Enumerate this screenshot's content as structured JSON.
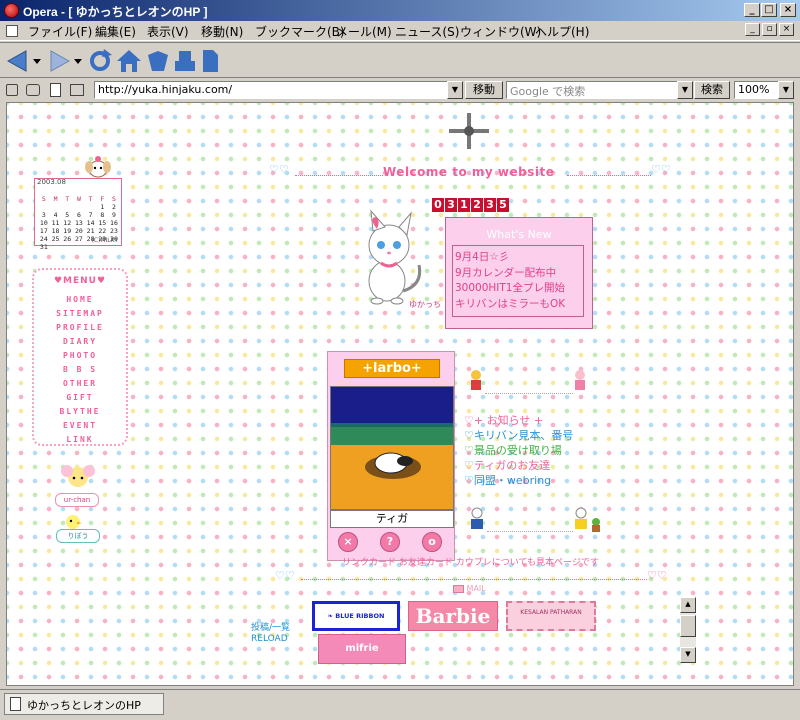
{
  "window": {
    "title": "Opera - [ ゆかっちとレオンのHP ]",
    "minimize": "_",
    "maximize": "□",
    "close": "×",
    "restore": "▫"
  },
  "menu": [
    "ファイル(F)",
    "編集(E)",
    "表示(V)",
    "移動(N)",
    "ブックマーク(B)",
    "メール(M)",
    "ニュース(S)",
    "ウィンドウ(W)",
    "ヘルプ(H)"
  ],
  "address": {
    "url": "http://yuka.hinjaku.com/",
    "go_label": "移動",
    "search_placeholder": "Google で検索",
    "search_label": "検索",
    "zoom": "100%"
  },
  "page": {
    "welcome": "Welcome to my website",
    "counter": [
      "0",
      "3",
      "1",
      "2",
      "3",
      "5"
    ],
    "calendar": {
      "header": "2003.08",
      "weekdays": [
        "S",
        "M",
        "T",
        "W",
        "T",
        "F",
        "S"
      ],
      "weeks": [
        [
          "",
          "",
          "",
          "",
          "",
          "1",
          "2"
        ],
        [
          "3",
          "4",
          "5",
          "6",
          "7",
          "8",
          "9"
        ],
        [
          "10",
          "11",
          "12",
          "13",
          "14",
          "15",
          "16"
        ],
        [
          "17",
          "18",
          "19",
          "20",
          "21",
          "22",
          "23"
        ],
        [
          "24",
          "25",
          "26",
          "27",
          "28",
          "29",
          "30"
        ],
        [
          "31",
          "",
          "",
          "",
          "",
          "",
          ""
        ]
      ],
      "copyright": "(C)MILKY"
    },
    "menu_title": "♥MENU♥",
    "menu_items": [
      "HOME",
      "SITEMAP",
      "PROFILE",
      "DIARY",
      "PHOTO",
      "B B S",
      "OTHER",
      "GIFT",
      "BLYTHE",
      "EVENT",
      "LINK"
    ],
    "side_chars": [
      "ur-chan",
      "りぼう"
    ],
    "cat_caption": "ゆかっち",
    "whats_new": {
      "title": "What's New",
      "items": [
        "9月4日☆彡",
        "9月カレンダー配布中",
        "30000HIT1全プレ開始",
        "キリバンはミラーもOK"
      ]
    },
    "harbot": {
      "logo": "+larbo+",
      "name": "ティガ",
      "buttons": [
        "×",
        "?",
        "o"
      ]
    },
    "info_items": [
      {
        "text": "+ お知らせ +",
        "color": "#f0609a"
      },
      {
        "text": "キリバン見本、番号",
        "color": "#2a8fd0"
      },
      {
        "text": "景品の受け取り場",
        "color": "#40b040"
      },
      {
        "text": "ティガのお友達",
        "color": "#f0609a"
      },
      {
        "text": "同盟・webring",
        "color": "#2a8fd0"
      }
    ],
    "caption": "リンクカード お友達カード カウプレについても見本ページです",
    "mail_label": "MAIL",
    "posts": [
      "投稿/一覧",
      "RELOAD"
    ],
    "banners": {
      "blue_ribbon": "BLUE RIBBON",
      "barbie": "Barbie",
      "kesalan": "KESALAN PATHARAN",
      "mifrie": "mifrie"
    }
  },
  "status": {
    "tab_title": "ゆかっちとレオンのHP"
  },
  "colors": {
    "accent_pink": "#f0609a",
    "title_blue": "#0a246a"
  }
}
